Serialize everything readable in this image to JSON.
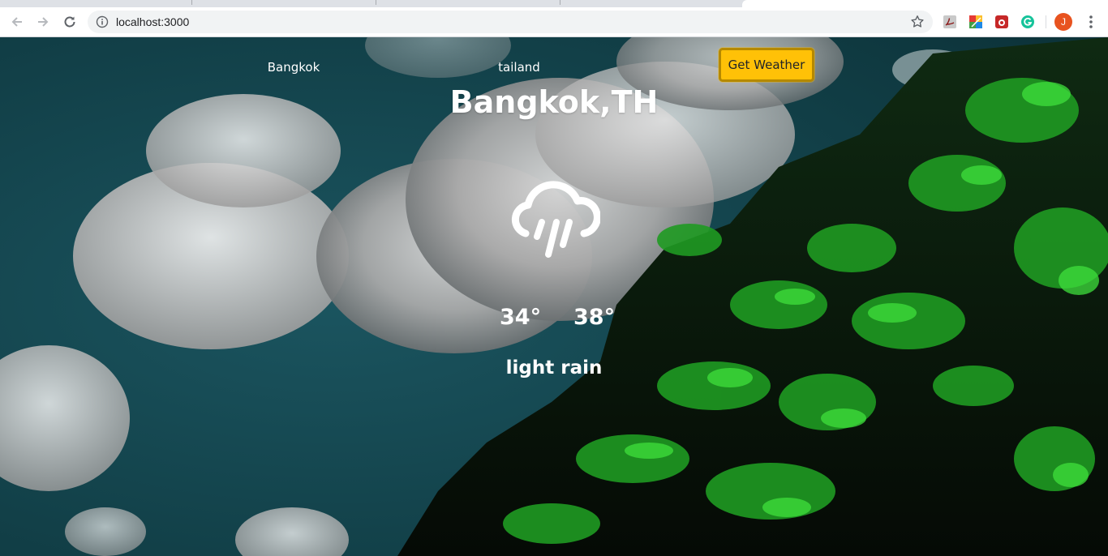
{
  "browser": {
    "url": "localhost:3000",
    "profile_initial": "J",
    "profile_color": "#e8531f",
    "icons": [
      "back-arrow-icon",
      "forward-arrow-icon",
      "reload-icon",
      "info-icon",
      "star-icon",
      "pdf-extension-icon",
      "color-extension-icon",
      "bug-extension-icon",
      "grammarly-extension-icon",
      "more-menu-icon"
    ]
  },
  "form": {
    "city_value": "Bangkok",
    "country_value": "tailand",
    "submit_label": "Get Weather",
    "button_color": "#ffc107"
  },
  "weather": {
    "location": "Bangkok,TH",
    "icon": "rain-cloud-icon",
    "temp_min": "34°",
    "temp_max": "38°",
    "description": "light rain"
  }
}
